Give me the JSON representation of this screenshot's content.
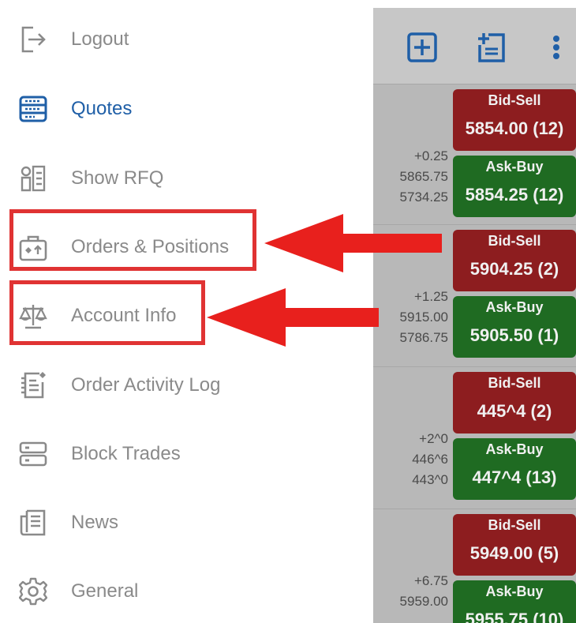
{
  "menu": {
    "items": [
      {
        "label": "Logout",
        "icon": "logout-icon"
      },
      {
        "label": "Quotes",
        "icon": "quotes-icon",
        "active": true
      },
      {
        "label": "Show RFQ",
        "icon": "rfq-icon"
      },
      {
        "label": "Orders & Positions",
        "icon": "briefcase-icon"
      },
      {
        "label": "Account Info",
        "icon": "balance-scale-icon"
      },
      {
        "label": "Order Activity Log",
        "icon": "activity-log-icon"
      },
      {
        "label": "Block Trades",
        "icon": "block-trades-icon"
      },
      {
        "label": "News",
        "icon": "news-icon"
      },
      {
        "label": "General",
        "icon": "gear-icon"
      }
    ]
  },
  "quotes": [
    {
      "change": "+0.25",
      "high": "5865.75",
      "low": "5734.25",
      "bid_label": "Bid-Sell",
      "bid": "5854.00 (12)",
      "ask_label": "Ask-Buy",
      "ask": "5854.25 (12)"
    },
    {
      "change": "+1.25",
      "high": "5915.00",
      "low": "5786.75",
      "bid_label": "Bid-Sell",
      "bid": "5904.25 (2)",
      "ask_label": "Ask-Buy",
      "ask": "5905.50 (1)"
    },
    {
      "change": "+2^0",
      "high": "446^6",
      "low": "443^0",
      "bid_label": "Bid-Sell",
      "bid": "445^4 (2)",
      "ask_label": "Ask-Buy",
      "ask": "447^4 (13)"
    },
    {
      "change": "+6.75",
      "high": "5959.00",
      "low": "",
      "bid_label": "Bid-Sell",
      "bid": "5949.00 (5)",
      "ask_label": "Ask-Buy",
      "ask": "5955.75 (10)"
    }
  ],
  "colors": {
    "accent": "#1f5fa7",
    "sell": "#8d1d1f",
    "buy": "#1f6b22",
    "highlight": "#e03333"
  }
}
